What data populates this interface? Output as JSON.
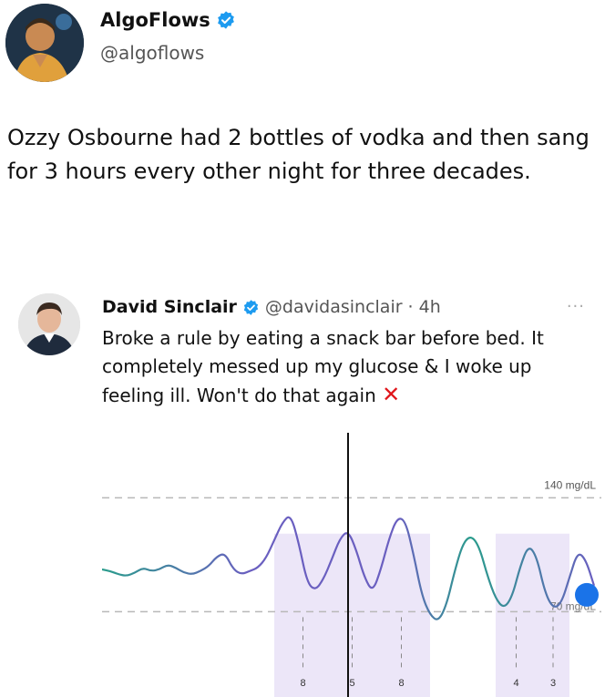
{
  "tweet": {
    "author_name": "AlgoFlows",
    "author_handle": "@algoflows",
    "text": "Ozzy Osbourne had 2 bottles of vodka and then  sang for 3 hours every other night for three decades."
  },
  "quoted": {
    "author_name": "David Sinclair",
    "author_handle": "@davidasinclair",
    "time": "· 4h",
    "more_label": "···",
    "text": "Broke a rule by eating a snack bar before bed. It completely messed up my glucose & I woke up feeling ill. Won't do that again",
    "x_mark": "✕"
  },
  "colors": {
    "verified": "#1d9bf0",
    "line": "#6a5fc0",
    "line_alt": "#2a9c8c",
    "shade": "#ece6f8",
    "dot": "#1a73e8",
    "xmark": "#e0161b"
  },
  "chart_data": {
    "type": "line",
    "upper_threshold_label": "140 mg/dL",
    "lower_threshold_label": "70 mg/dL",
    "upper_threshold": 140,
    "lower_threshold": 70,
    "ylim": [
      40,
      180
    ],
    "grid": false,
    "x": [
      0,
      1,
      2,
      3,
      4,
      5,
      6,
      7,
      8,
      9,
      10,
      11,
      12,
      13,
      14,
      15,
      16,
      17,
      18,
      19,
      20,
      21,
      22,
      23,
      24,
      25,
      26,
      27,
      28,
      29,
      30,
      31,
      32,
      33,
      34,
      35,
      36,
      37,
      38,
      39,
      40,
      41,
      42,
      43,
      44,
      45,
      46,
      47,
      48,
      49,
      50,
      51,
      52,
      53,
      54,
      55,
      56,
      57,
      58,
      59,
      60
    ],
    "series": [
      {
        "values": [
          96,
          95,
          93,
          92,
          94,
          97,
          95,
          96,
          99,
          97,
          94,
          93,
          95,
          98,
          104,
          106,
          96,
          93,
          95,
          97,
          103,
          114,
          125,
          130,
          112,
          88,
          83,
          90,
          102,
          115,
          120,
          108,
          91,
          82,
          96,
          115,
          128,
          126,
          105,
          80,
          68,
          64,
          74,
          95,
          112,
          117,
          110,
          92,
          78,
          72,
          79,
          98,
          111,
          104,
          82,
          72,
          75,
          91,
          107,
          102,
          86
        ]
      }
    ],
    "shaded_bands": [
      {
        "label": "8",
        "x_start": 21,
        "x_end": 28
      },
      {
        "label": "5",
        "x_start": 28,
        "x_end": 33
      },
      {
        "label": "8",
        "x_start": 33,
        "x_end": 40
      },
      {
        "label": "4",
        "x_start": 48,
        "x_end": 53
      },
      {
        "label": "3",
        "x_start": 53,
        "x_end": 57
      }
    ],
    "cursor_x": 30,
    "marker_x": 60
  }
}
